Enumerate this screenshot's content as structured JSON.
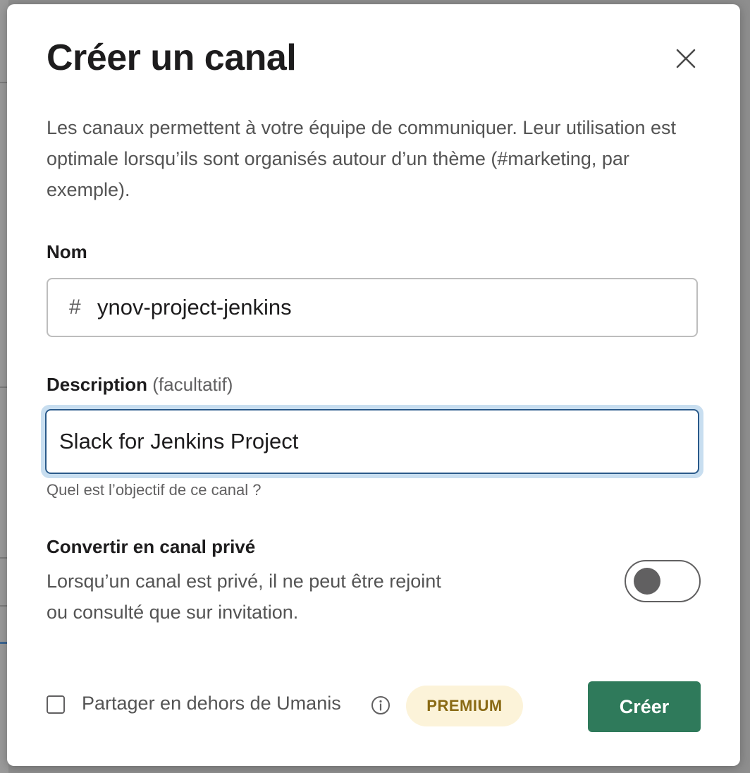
{
  "modal": {
    "title": "Créer un canal",
    "close_icon": "close-icon",
    "intro": "Les canaux permettent à votre équipe de communiquer. Leur utilisation est optimale lorsqu’ils sont organisés autour d’un thème (#marketing, par exemple)."
  },
  "name_field": {
    "label": "Nom",
    "prefix": "#",
    "value": "ynov-project-jenkins"
  },
  "description_field": {
    "label": "Description",
    "optional": "(facultatif)",
    "value": "Slack for Jenkins Project",
    "hint": "Quel est l’objectif de ce canal ?"
  },
  "private_option": {
    "title": "Convertir en canal privé",
    "description": "Lorsqu’un canal est privé, il ne peut être rejoint ou consulté que sur invitation.",
    "enabled": false
  },
  "footer": {
    "share_label": "Partager en dehors de Umanis",
    "share_checked": false,
    "info_icon": "info-icon",
    "premium_badge": "PREMIUM",
    "create_label": "Créer"
  },
  "colors": {
    "primary_button": "#2f7a5b",
    "focus_ring": "#c8def0",
    "focus_border": "#2a5a8a",
    "premium_bg": "#fcf3d9",
    "premium_text": "#8a6a14"
  }
}
